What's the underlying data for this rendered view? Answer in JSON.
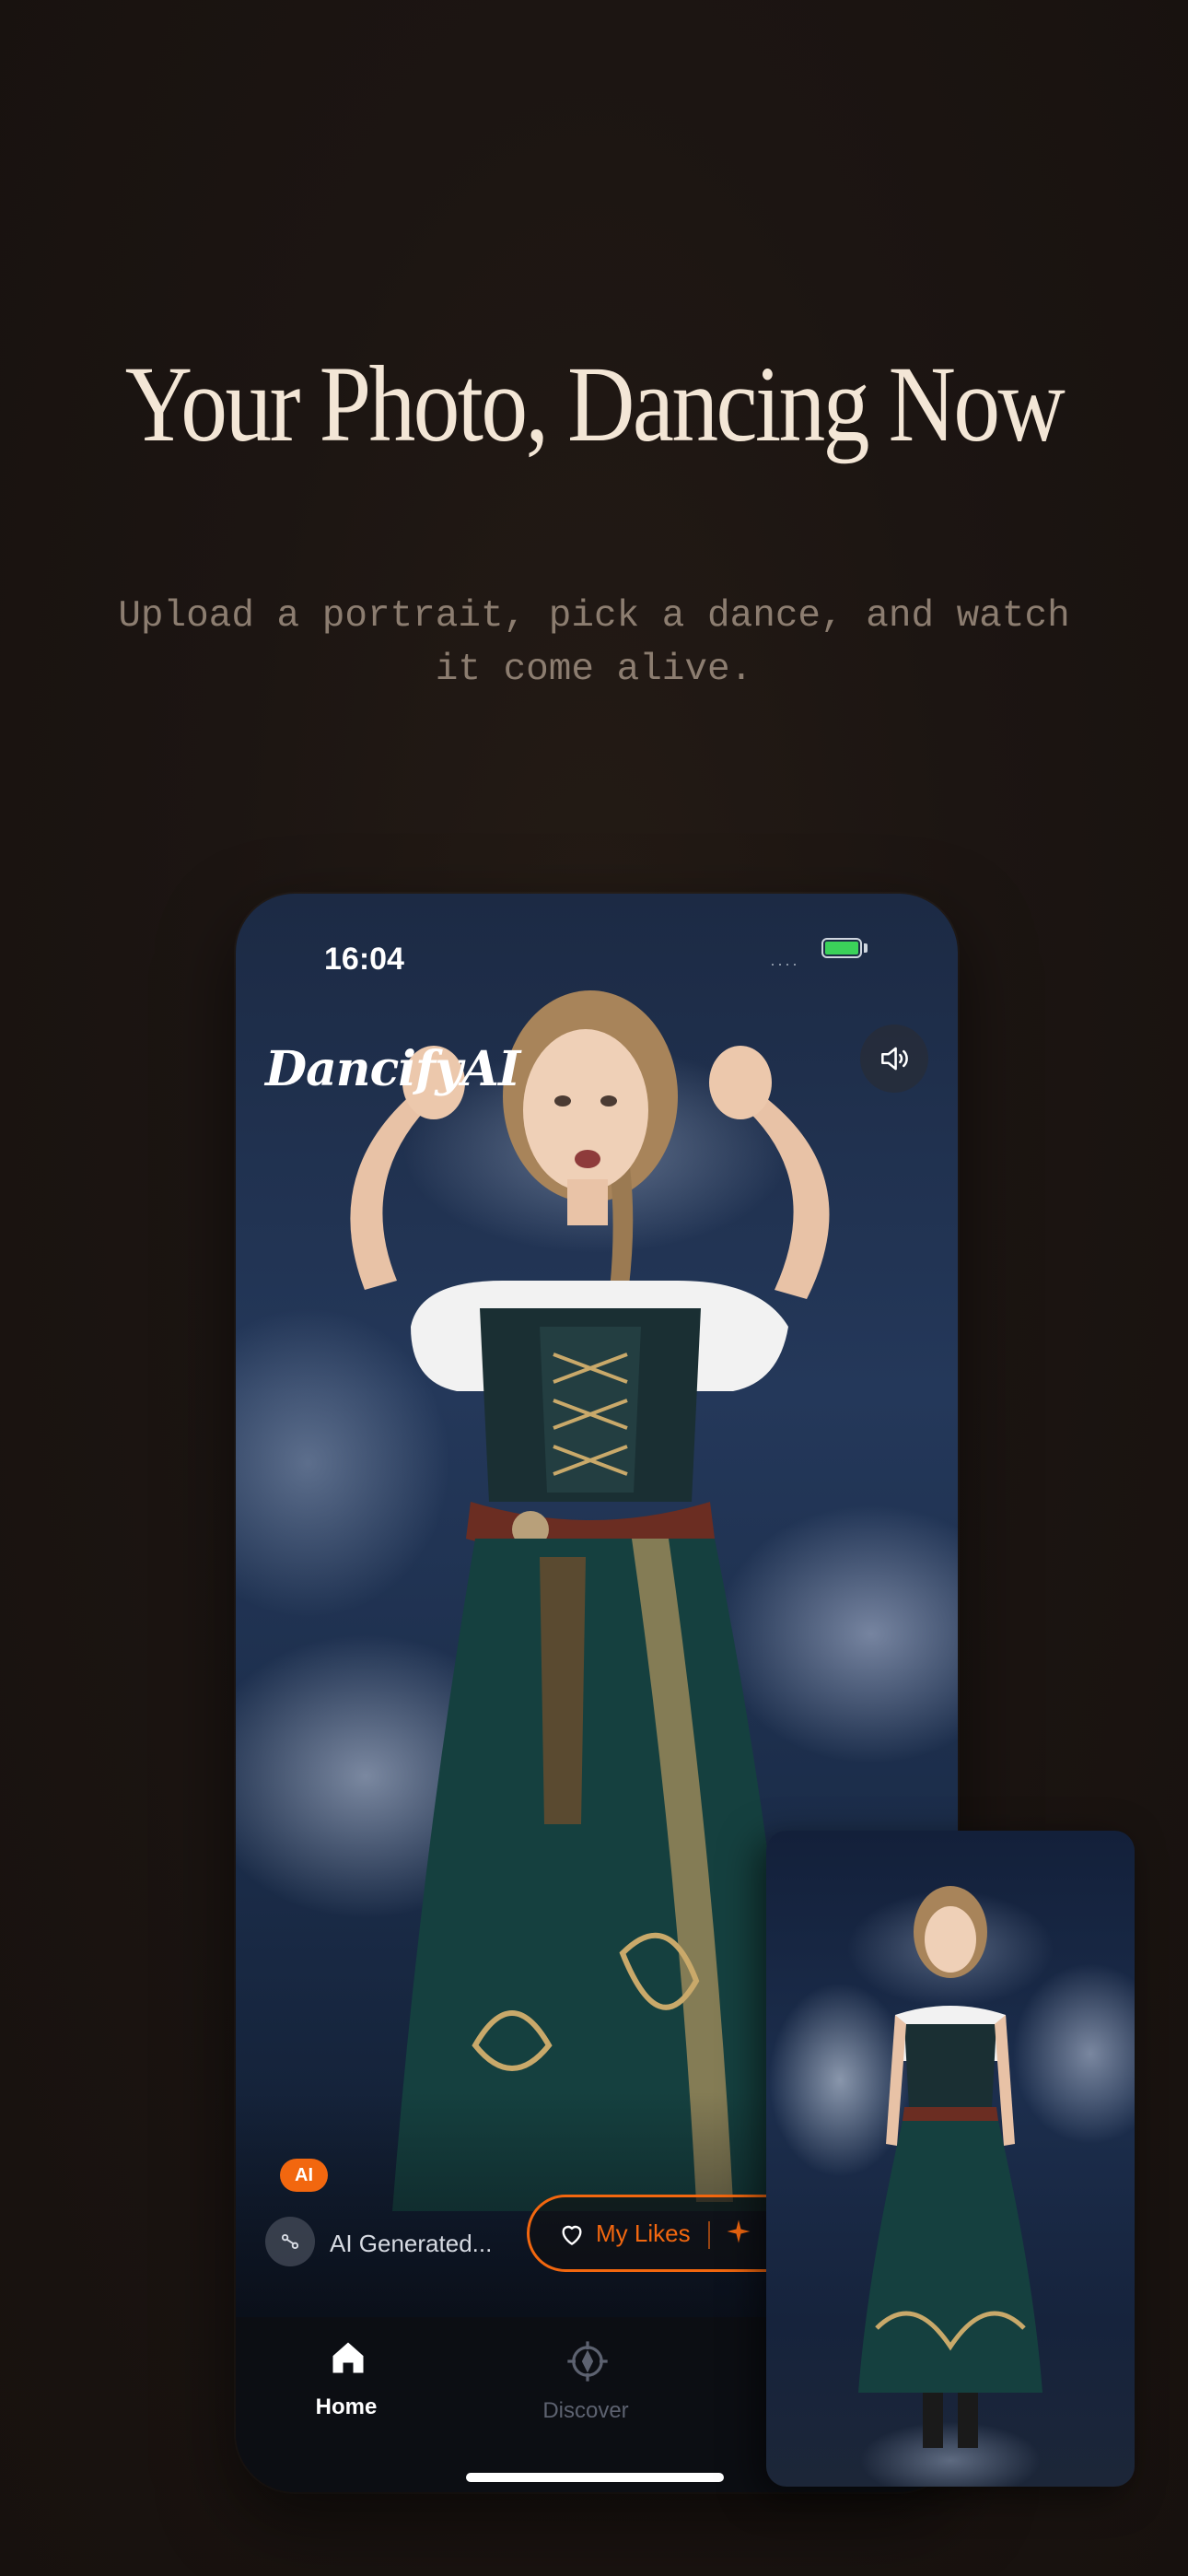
{
  "hero": {
    "headline": "Your Photo, Dancing Now",
    "subline": "Upload a portrait, pick a dance, and watch it come alive."
  },
  "phone": {
    "status_bar": {
      "time": "16:04",
      "signal": "····"
    },
    "app_logo": "DancifyAI",
    "badge": "AI",
    "generated_text": "AI Generated...",
    "likes_label": "My Likes",
    "nav": {
      "home": "Home",
      "discover": "Discover"
    }
  },
  "colors": {
    "accent": "#f2670f",
    "background": "#1c1512",
    "headline": "#f3e6d6",
    "subline": "#8c7d70",
    "battery": "#3bd15a"
  },
  "icons": {
    "sound": "speaker-icon",
    "heart": "heart-icon",
    "sparkle": "sparkle-icon",
    "home": "home-icon",
    "discover": "compass-icon",
    "generated": "link-icon"
  }
}
